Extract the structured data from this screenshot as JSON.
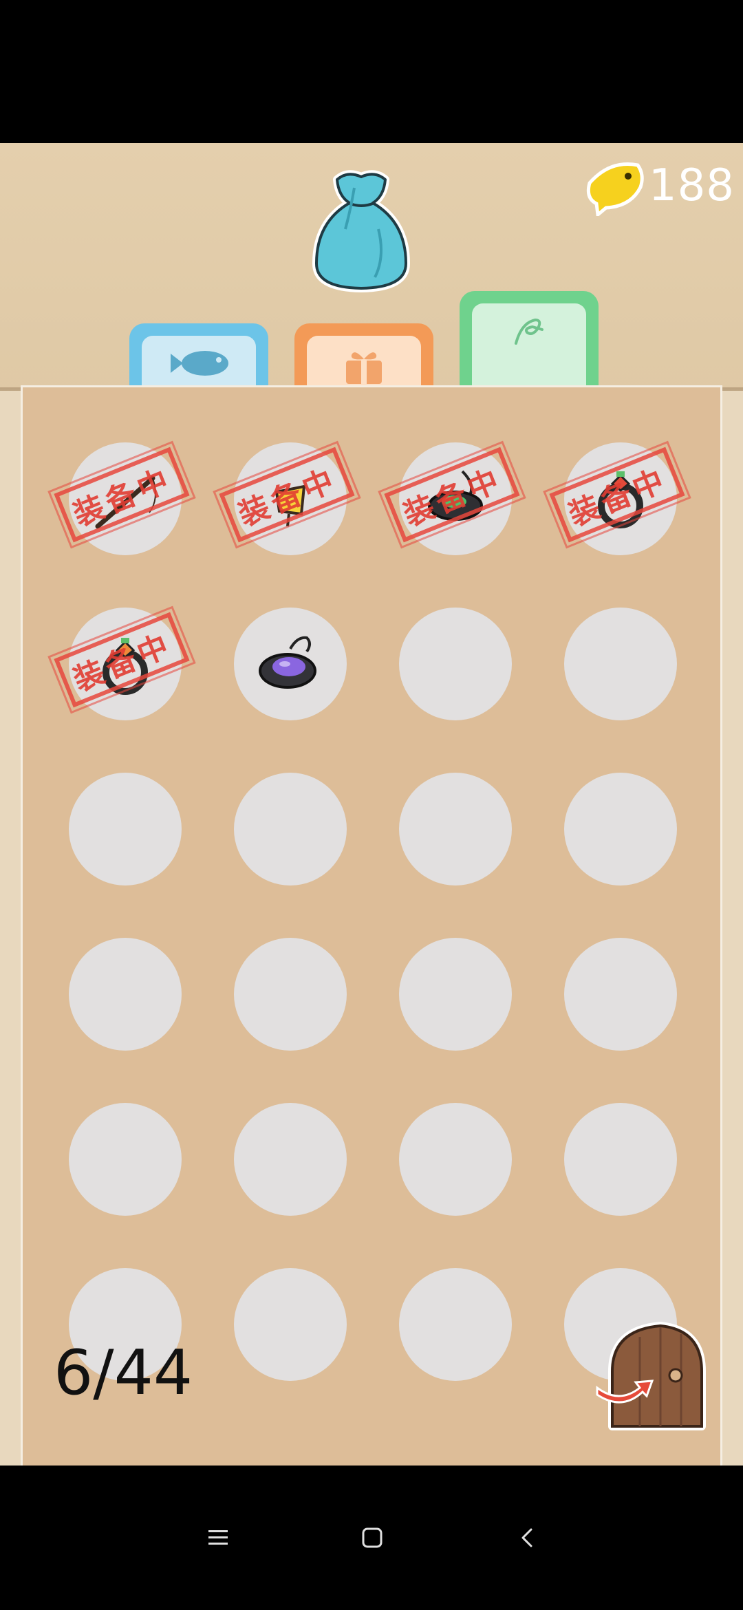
{
  "currency": {
    "icon": "fish-coin-icon",
    "amount": "188"
  },
  "header": {
    "icon": "bag-icon"
  },
  "tabs": [
    {
      "id": "fish",
      "icon": "fish-icon",
      "color": "#6cc4e8"
    },
    {
      "id": "gift",
      "icon": "gift-icon",
      "color": "#f39a57"
    },
    {
      "id": "equipment",
      "icon": "fishing-line-icon",
      "color": "#6fd28d",
      "selected": true
    }
  ],
  "inventory": {
    "equipped_stamp": "装备中",
    "count": "6/44",
    "slots": [
      {
        "item": "fishing-rod-icon",
        "equipped": true
      },
      {
        "item": "lure-icon",
        "equipped": true
      },
      {
        "item": "green-gem-necklace-icon",
        "equipped": true
      },
      {
        "item": "red-gem-ring-icon",
        "equipped": true
      },
      {
        "item": "orange-gem-ring-icon",
        "equipped": true
      },
      {
        "item": "purple-gem-necklace-icon",
        "equipped": false
      }
    ]
  },
  "exit": {
    "icon": "door-exit-icon"
  },
  "navbar": {
    "items": [
      "menu-icon",
      "home-icon",
      "back-icon"
    ]
  }
}
